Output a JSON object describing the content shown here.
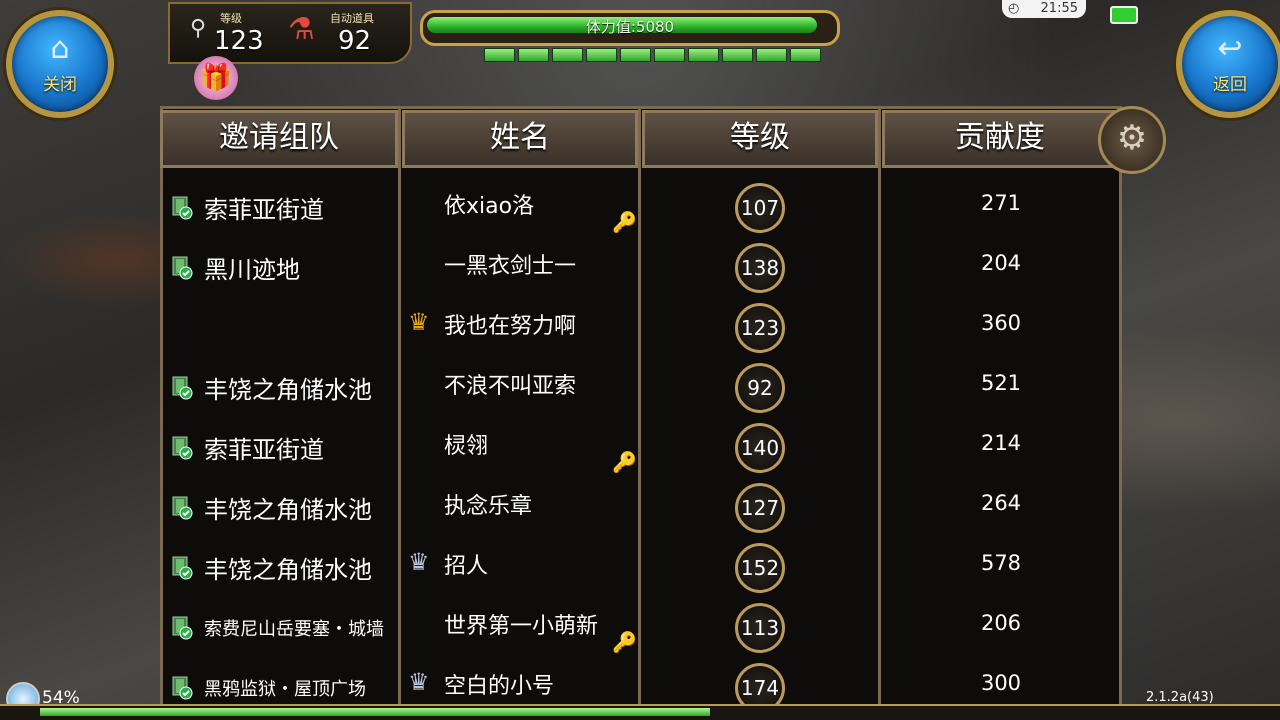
{
  "header": {
    "close_label": "关闭",
    "back_label": "返回",
    "level_label": "等级",
    "level_value": "123",
    "auto_item_label": "自动道具",
    "auto_item_value": "92",
    "stamina_text": "体力值:5080",
    "stamina_fraction": 0.97,
    "energy_segments": 10,
    "clock": "21:55"
  },
  "table": {
    "headers": [
      "邀请组队",
      "姓名",
      "等级",
      "贡献度"
    ],
    "rows": [
      {
        "location": "索菲亚街道",
        "name": "依xiao洛",
        "level": "107",
        "contribution": "271",
        "badge": "key"
      },
      {
        "location": "黑川迹地",
        "name": "一黑衣剑士一",
        "level": "138",
        "contribution": "204",
        "badge": ""
      },
      {
        "location": "",
        "name": "我也在努力啊",
        "level": "123",
        "contribution": "360",
        "badge": "gold-crown"
      },
      {
        "location": "丰饶之角储水池",
        "name": "不浪不叫亚索",
        "level": "92",
        "contribution": "521",
        "badge": ""
      },
      {
        "location": "索菲亚街道",
        "name": "棂翎",
        "level": "140",
        "contribution": "214",
        "badge": "key"
      },
      {
        "location": "丰饶之角储水池",
        "name": "执念乐章",
        "level": "127",
        "contribution": "264",
        "badge": ""
      },
      {
        "location": "丰饶之角储水池",
        "name": "招人",
        "level": "152",
        "contribution": "578",
        "badge": "silver-crown"
      },
      {
        "location": "索费尼山岳要塞・城墙",
        "name": "世界第一小萌新",
        "level": "113",
        "contribution": "206",
        "badge": "key"
      },
      {
        "location": "黑鸦监狱・屋顶广场",
        "name": "空白的小号",
        "level": "174",
        "contribution": "300",
        "badge": "silver-crown"
      }
    ]
  },
  "footer": {
    "percent": "54%",
    "version": "2.1.2a(43)",
    "progress_fraction": 0.54
  },
  "colors": {
    "accent_gold": "#c9a24a",
    "stamina_green": "#2db12b",
    "button_blue": "#1673c9"
  }
}
